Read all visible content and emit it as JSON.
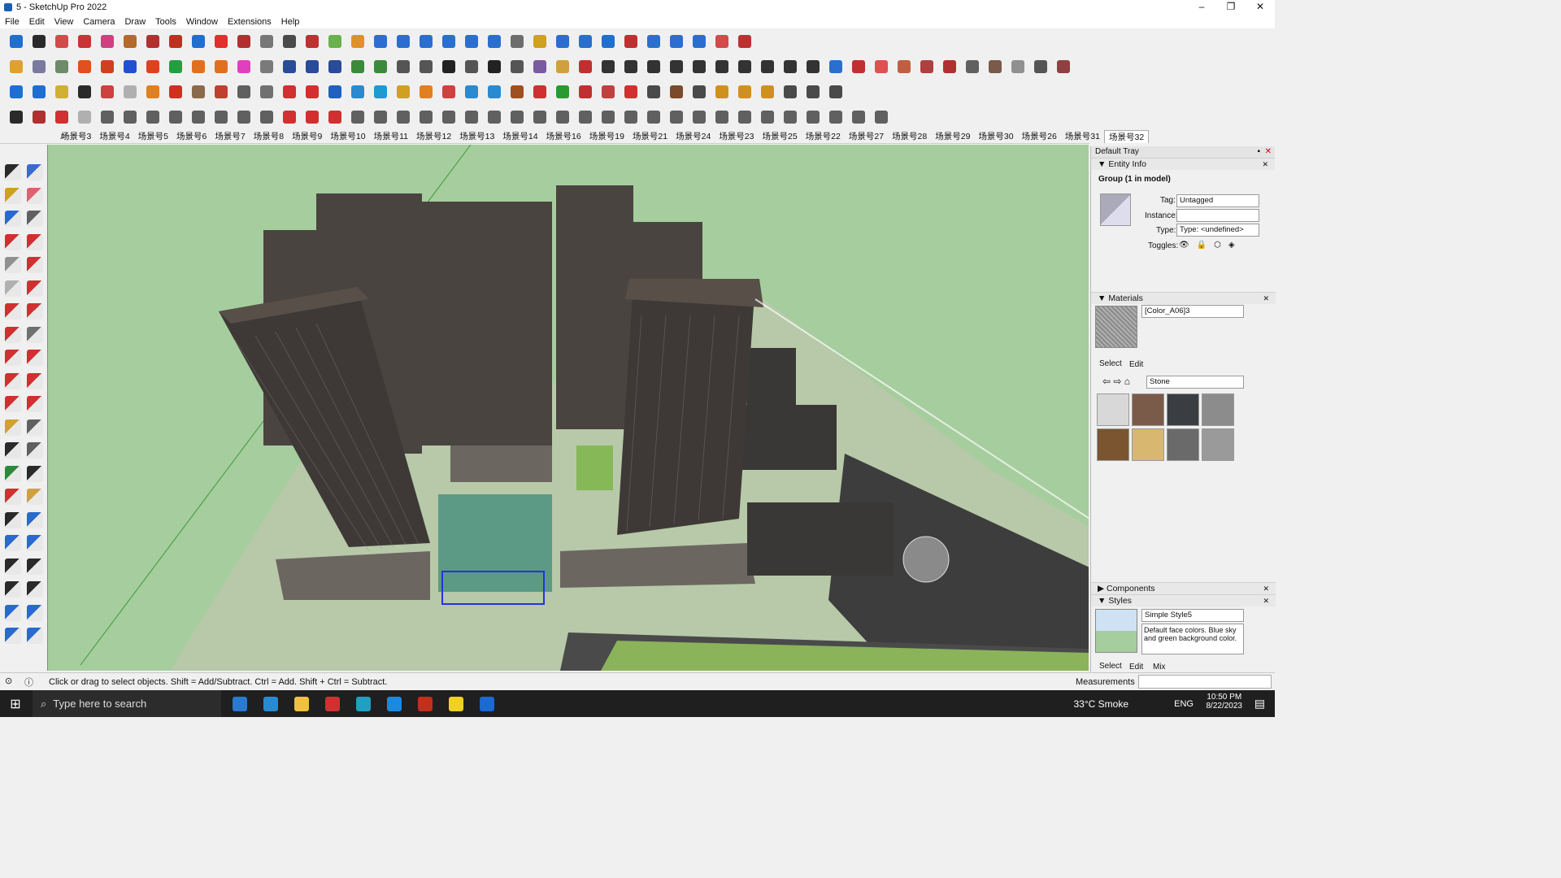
{
  "window": {
    "title": "5 - SketchUp Pro 2022",
    "controls": [
      "–",
      "❐",
      "✕"
    ]
  },
  "menu": [
    "File",
    "Edit",
    "View",
    "Camera",
    "Draw",
    "Tools",
    "Window",
    "Extensions",
    "Help"
  ],
  "toolbars": {
    "row1": [
      "#1e6fd0",
      "#2a2a2a",
      "#d24a4a",
      "#c83333",
      "#d04080",
      "#b46a2a",
      "#b03030",
      "#c03020",
      "#1e6fd0",
      "#e0302a",
      "#b03030",
      "#777",
      "#4a4a4a",
      "#c03030",
      "#6ab04c",
      "#e0902a",
      "#2a6fd0",
      "#2a6fd0",
      "#2a6fd0",
      "#2a6fd0",
      "#2a6fd0",
      "#2a6fd0",
      "#6d6d6d",
      "#d0a020",
      "#2a6fd0",
      "#2a6fd0",
      "#1e6fd0",
      "#c03030",
      "#2a6fd0",
      "#2a6fd0",
      "#2a6fd0",
      "#d24a4a",
      "#c03030"
    ],
    "row2": [
      "#e0a030",
      "#7a7aa0",
      "#6f8a6a",
      "#e05020",
      "#d04020",
      "#2050d0",
      "#e04020",
      "#20a040",
      "#e07020",
      "#e07020",
      "#e040c0",
      "#7a7a7a",
      "#2a4a9a",
      "#2a4a9a",
      "#2a4a9a",
      "#3a8a3a",
      "#3a8a3a",
      "#555",
      "#555",
      "#222",
      "#555",
      "#222",
      "#555",
      "#7a5aa0",
      "#d0a040",
      "#c03030",
      "#333",
      "#333",
      "#333",
      "#333",
      "#333",
      "#333",
      "#333",
      "#333",
      "#333",
      "#333",
      "#2a6fd0",
      "#c03030",
      "#e05050",
      "#c06040",
      "#b04040",
      "#b03030",
      "#606060",
      "#7a5a4a",
      "#909090",
      "#555",
      "#904040"
    ],
    "row3": [
      "#1e6fd0",
      "#1e6fd0",
      "#d0b030",
      "#2a2a2a",
      "#d04040",
      "#b0b0b0",
      "#e08020",
      "#d03020",
      "#8a6a4a",
      "#c04030",
      "#606060",
      "#707070",
      "#d03030",
      "#d03030",
      "#2060c0",
      "#2a8ad0",
      "#1e9ad0",
      "#d0a020",
      "#e08020",
      "#d04040",
      "#2a8ad0",
      "#2a8ad0",
      "#a05020",
      "#d03030",
      "#2a9a30",
      "#c03030",
      "#c04040",
      "#d03030",
      "#4a4a4a",
      "#7a4a2a",
      "#4a4a4a",
      "#d09020",
      "#d09020",
      "#d09020",
      "#4a4a4a",
      "#4a4a4a",
      "#4a4a4a"
    ],
    "row4": [
      "#2a2a2a",
      "#b03030",
      "#d03030",
      "#b0b0b0",
      "#606060",
      "#606060",
      "#606060",
      "#606060",
      "#606060",
      "#606060",
      "#606060",
      "#606060",
      "#d03030",
      "#d03030",
      "#d03030",
      "#606060",
      "#606060",
      "#606060",
      "#606060",
      "#606060",
      "#606060",
      "#606060",
      "#606060",
      "#606060",
      "#606060",
      "#606060",
      "#606060",
      "#606060",
      "#606060",
      "#606060",
      "#606060",
      "#606060",
      "#606060",
      "#606060",
      "#606060",
      "#606060",
      "#606060",
      "#606060",
      "#606060"
    ]
  },
  "scenes": [
    "场景号3",
    "场景号4",
    "场景号5",
    "场景号6",
    "场景号7",
    "场景号8",
    "场景号9",
    "场景号10",
    "场景号11",
    "场景号12",
    "场景号13",
    "场景号14",
    "场景号16",
    "场景号19",
    "场景号21",
    "场景号24",
    "场景号23",
    "场景号25",
    "场景号22",
    "场景号27",
    "场景号28",
    "场景号29",
    "场景号30",
    "场景号26",
    "场景号31",
    "场景号32"
  ],
  "active_scene": "场景号32",
  "left_tools": [
    "select",
    "orbit",
    "paint-bucket",
    "eraser",
    "make-component",
    "tape",
    "line",
    "freehand",
    "rectangle",
    "rotated-rect",
    "circle",
    "polygon",
    "arc",
    "pie",
    "arc-3pt",
    "arc-2pt",
    "move",
    "push-pull",
    "rotate",
    "follow-me",
    "scale",
    "offset",
    "tape-measure",
    "dimension",
    "protractor",
    "text",
    "axes",
    "3d-text",
    "orbit-tool",
    "pan",
    "zoom",
    "zoom-window",
    "zoom-extents",
    "previous",
    "position-camera",
    "look-around",
    "walk",
    "section-plane",
    "sandbox-1",
    "sandbox-2",
    "sandbox-3",
    "sandbox-4"
  ],
  "tray": {
    "title": "Default Tray",
    "entity_info": {
      "header": "Entity Info",
      "entity": "Group (1 in model)",
      "tag_label": "Tag:",
      "tag_value": "Untagged",
      "instance_label": "Instance:",
      "instance_value": "",
      "type_label": "Type:",
      "type_value": "Type: <undefined>",
      "toggles_label": "Toggles:"
    },
    "materials": {
      "header": "Materials",
      "current": "[Color_A06]3",
      "tab_select": "Select",
      "tab_edit": "Edit",
      "library": "Stone",
      "swatches": [
        "#d8d8d8",
        "#7a5a48",
        "#3a3d42",
        "#8c8c8c",
        "#7a5530",
        "#d8b870",
        "#6a6a6a",
        "#9a9a9a"
      ]
    },
    "components": {
      "header": "Components"
    },
    "styles": {
      "header": "Styles",
      "name": "Simple Style5",
      "description": "Default face colors. Blue sky and green background color.",
      "tab_select": "Select",
      "tab_edit": "Edit",
      "tab_mix": "Mix"
    }
  },
  "status": {
    "hint": "Click or drag to select objects. Shift = Add/Subtract. Ctrl = Add. Shift + Ctrl = Subtract.",
    "measurements_label": "Measurements",
    "measurements_value": ""
  },
  "taskbar": {
    "search_placeholder": "Type here to search",
    "weather": "33°C  Smoke",
    "lang": "ENG",
    "time": "10:50 PM",
    "date": "8/22/2023",
    "apps": [
      "#2a7ad0",
      "#2a8ad0",
      "#f0c040",
      "#d03030",
      "#1fa0c0",
      "#1a8ae0",
      "#c0301a",
      "#f0d020",
      "#1a6ad0"
    ]
  }
}
